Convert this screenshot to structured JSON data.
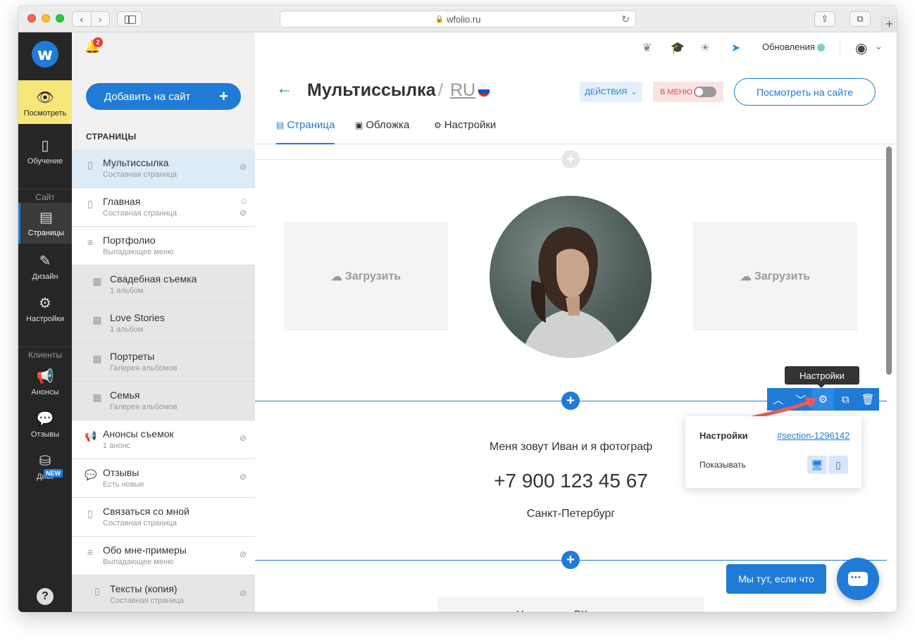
{
  "browser": {
    "url": "wfolio.ru"
  },
  "nav": {
    "logo": "w",
    "items": [
      {
        "label": "Посмотреть",
        "icon": "eye-icon"
      },
      {
        "label": "Обучение",
        "icon": "book-icon"
      },
      {
        "label": "Страницы",
        "icon": "page-icon"
      },
      {
        "label": "Дизайн",
        "icon": "brush-icon"
      },
      {
        "label": "Настройки",
        "icon": "gear-icon"
      },
      {
        "label": "Анонсы",
        "icon": "megaphone-icon"
      },
      {
        "label": "Отзывы",
        "icon": "chat-icon"
      },
      {
        "label": "Диск",
        "icon": "database-icon"
      }
    ],
    "section_site": "Сайт",
    "section_clients": "Клиенты",
    "new_badge": "NEW",
    "help": "?"
  },
  "panel": {
    "notifications": "2",
    "add_button": "Добавить на сайт",
    "title": "СТРАНИЦЫ",
    "pages": [
      {
        "title": "Мультиссылка",
        "sub": "Составная страница"
      },
      {
        "title": "Главная",
        "sub": "Составная страница"
      },
      {
        "title": "Портфолио",
        "sub": "Выпадающее меню"
      },
      {
        "title": "Свадебная съемка",
        "sub": "1 альбом"
      },
      {
        "title": "Love Stories",
        "sub": "1 альбом"
      },
      {
        "title": "Портреты",
        "sub": "Галерея альбомов"
      },
      {
        "title": "Семья",
        "sub": "Галерея альбомов"
      },
      {
        "title": "Анонсы съемок",
        "sub": "1 анонс"
      },
      {
        "title": "Отзывы",
        "sub": "Есть новые"
      },
      {
        "title": "Связаться со мной",
        "sub": "Составная страница"
      },
      {
        "title": "Обо мне-примеры",
        "sub": "Выпадающее меню"
      },
      {
        "title": "Тексты (копия)",
        "sub": "Составная страница"
      }
    ]
  },
  "topbar": {
    "updates": "Обновления"
  },
  "header": {
    "title": "Мультиссылка",
    "lang": "RU",
    "actions": "ДЕЙСТВИЯ",
    "in_menu": "В МЕНЮ",
    "view_site": "Посмотреть на сайте",
    "tabs": [
      "Страница",
      "Обложка",
      "Настройки"
    ]
  },
  "content": {
    "upload_left": "Загрузить",
    "upload_right": "Загрузить",
    "intro": "Меня зовут Иван и я фотограф",
    "phone": "+7 900 123 45 67",
    "city": "Санкт-Петербург",
    "vk_button": "Написать в ВКонтакте",
    "tooltip": "Настройки",
    "popup": {
      "settings_label": "Настройки",
      "section_id": "#section-1296142",
      "show_label": "Показывать"
    },
    "chat_label": "Мы тут, если что"
  },
  "colors": {
    "accent": "#1f7bd6",
    "nav_bg": "#262626",
    "active_nav": "#f7e77a"
  }
}
